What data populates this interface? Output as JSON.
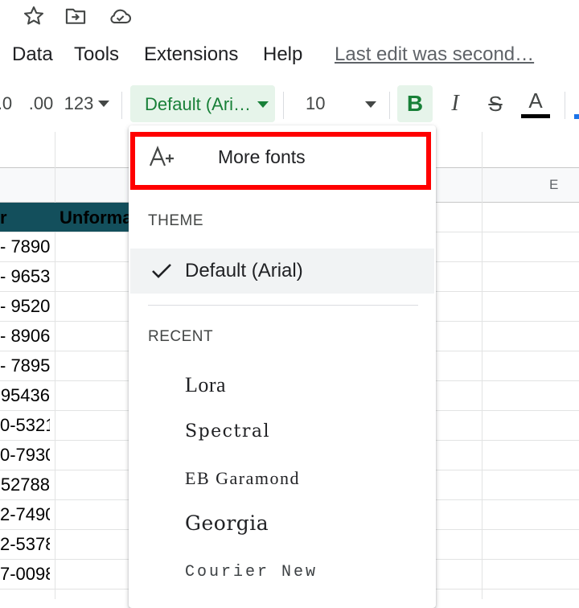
{
  "top_icons": [
    "star-icon",
    "move-to-folder-icon",
    "cloud-saved-icon"
  ],
  "menubar": {
    "items": [
      "Data",
      "Tools",
      "Extensions",
      "Help"
    ],
    "last_edit": "Last edit was second…"
  },
  "toolbar": {
    "decrease_decimal": ".0",
    "increase_decimal": ".00",
    "more_formats": "123",
    "font": "Default (Ari…",
    "font_size": "10",
    "bold": "B",
    "italic": "I",
    "strikethrough": "S",
    "text_color": "A",
    "text_color_value": "#000000"
  },
  "sheet": {
    "column_e": "E",
    "header_col_a": "r",
    "header_col_b": "Unforma",
    "col_a_cells": [
      "- 7890",
      "- 9653",
      "- 9520",
      "- 8906",
      "- 7895",
      "95436",
      "0-5321",
      "0-7930",
      "52788",
      "2-7490",
      "2-5378",
      "7-0098"
    ]
  },
  "dropdown": {
    "more_fonts": "More fonts",
    "theme_section": "THEME",
    "theme_item": "Default (Arial)",
    "recent_section": "RECENT",
    "recent_items": [
      "Lora",
      "Spectral",
      "EB Garamond",
      "Georgia",
      "Courier New"
    ]
  },
  "colors": {
    "accent_green": "#188038",
    "accent_bg": "#e6f4ea",
    "highlight_border": "#ff0000",
    "header_fill": "#134f5c"
  }
}
